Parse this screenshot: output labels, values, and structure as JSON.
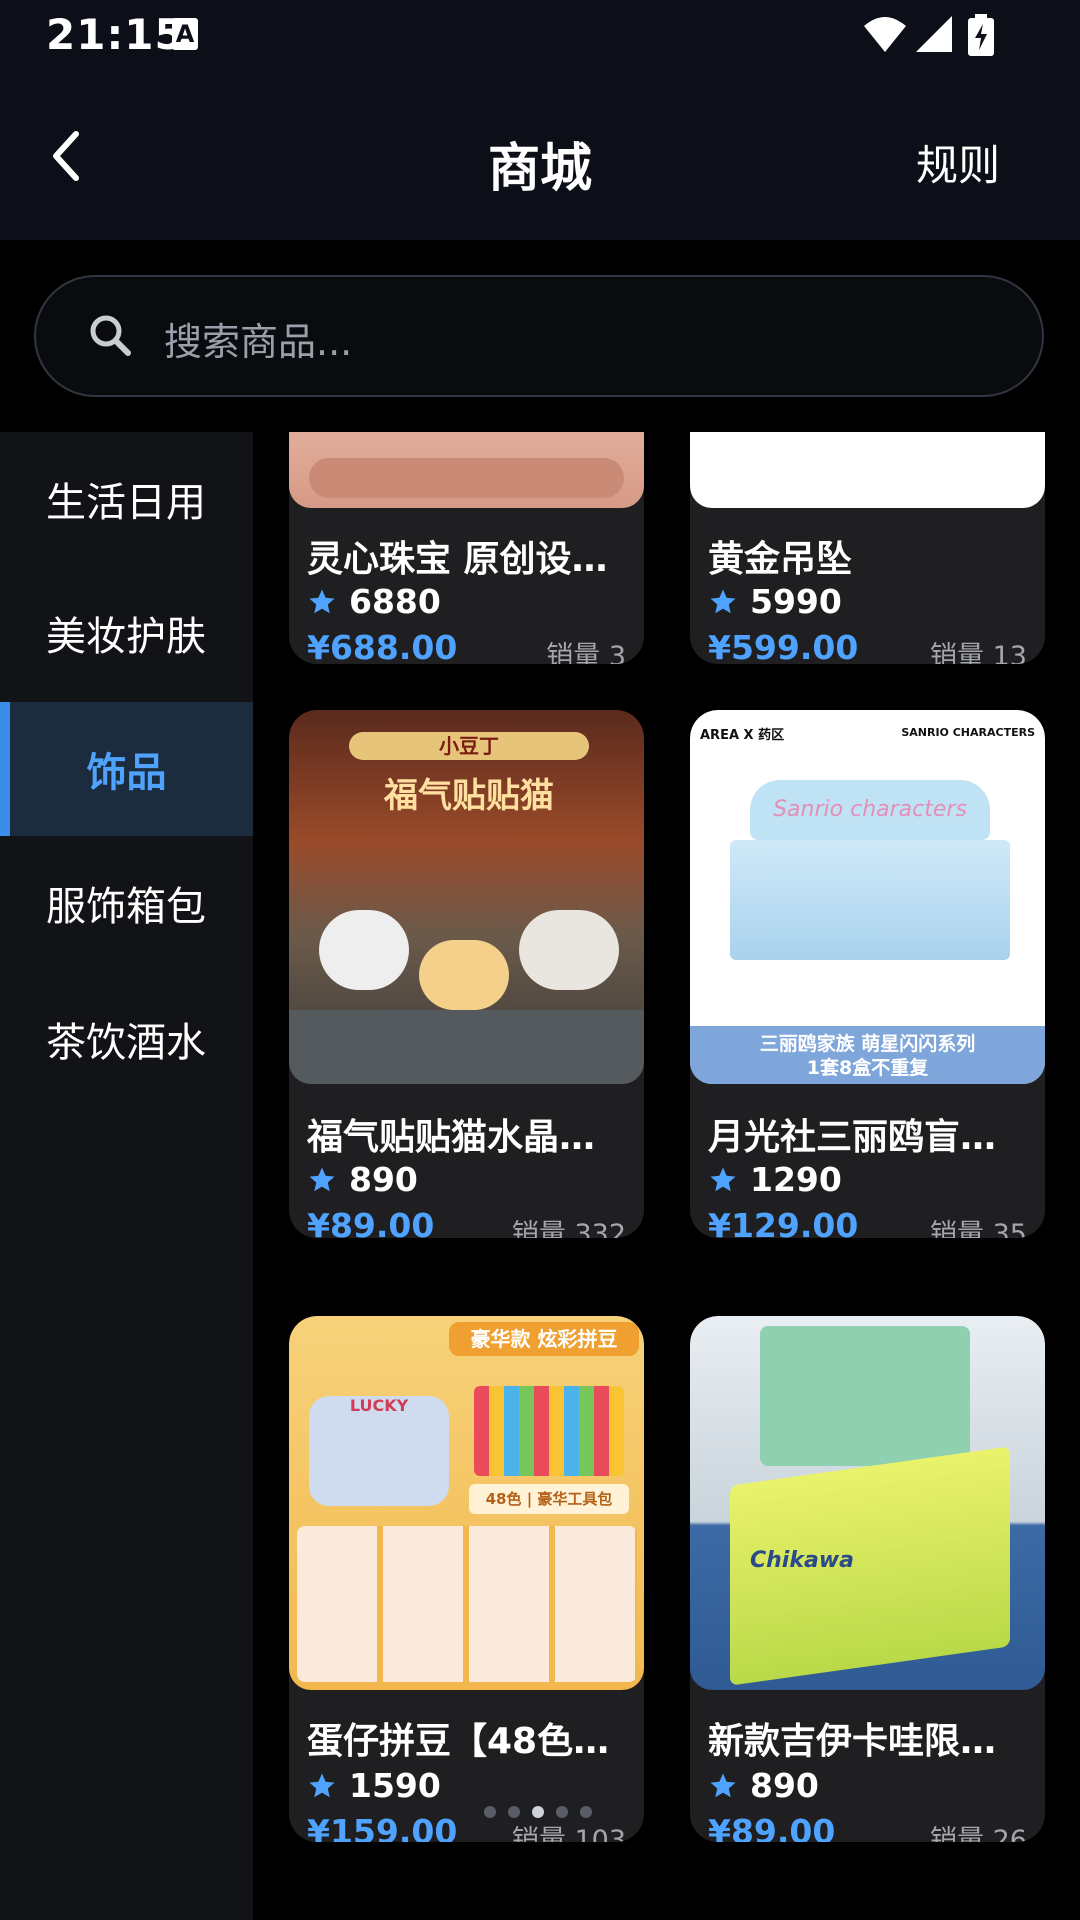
{
  "status_bar": {
    "time": "21:15",
    "notification_icon": "A"
  },
  "header": {
    "back_icon": "chevron-left-icon",
    "title": "商城",
    "rules": "规则"
  },
  "search": {
    "placeholder": "搜索商品..."
  },
  "sidebar": {
    "items": [
      {
        "label": "生活日用"
      },
      {
        "label": "美妆护肤"
      },
      {
        "label": "饰品",
        "active": true
      },
      {
        "label": "服饰箱包"
      },
      {
        "label": "茶饮酒水"
      }
    ]
  },
  "products": [
    {
      "title": "灵心珠宝 原创设…",
      "points": "6880",
      "price": "¥688.00",
      "sales": "销量 3"
    },
    {
      "title": "黄金吊坠",
      "points": "5990",
      "price": "¥599.00",
      "sales": "销量 13"
    },
    {
      "title": "福气贴贴猫水晶…",
      "points": "890",
      "price": "¥89.00",
      "sales": "销量 332",
      "img_text": [
        "小豆丁",
        "福气贴贴猫"
      ]
    },
    {
      "title": "月光社三丽鸥盲…",
      "points": "1290",
      "price": "¥129.00",
      "sales": "销量 35",
      "img_text": [
        "AREA X 药区",
        "SANRIO CHARACTERS",
        "Sanrio characters",
        "三丽鸥家族 萌星闪闪系列",
        "1套8盒不重复"
      ]
    },
    {
      "title": "蛋仔拼豆【48色…",
      "points": "1590",
      "price": "¥159.00",
      "sales": "销量 103",
      "img_text": [
        "豪华款",
        "炫彩拼豆",
        "48色 | 豪华工具包",
        "LUCKY"
      ]
    },
    {
      "title": "新款吉伊卡哇限…",
      "points": "890",
      "price": "¥89.00",
      "sales": "销量 26",
      "img_text": [
        "Chikawa"
      ]
    }
  ],
  "pager": {
    "count": 5,
    "active": 2
  },
  "colors": {
    "accent": "#4fa3ff",
    "background": "#000000",
    "card": "#1f1f22",
    "sidebar": "#121316"
  }
}
